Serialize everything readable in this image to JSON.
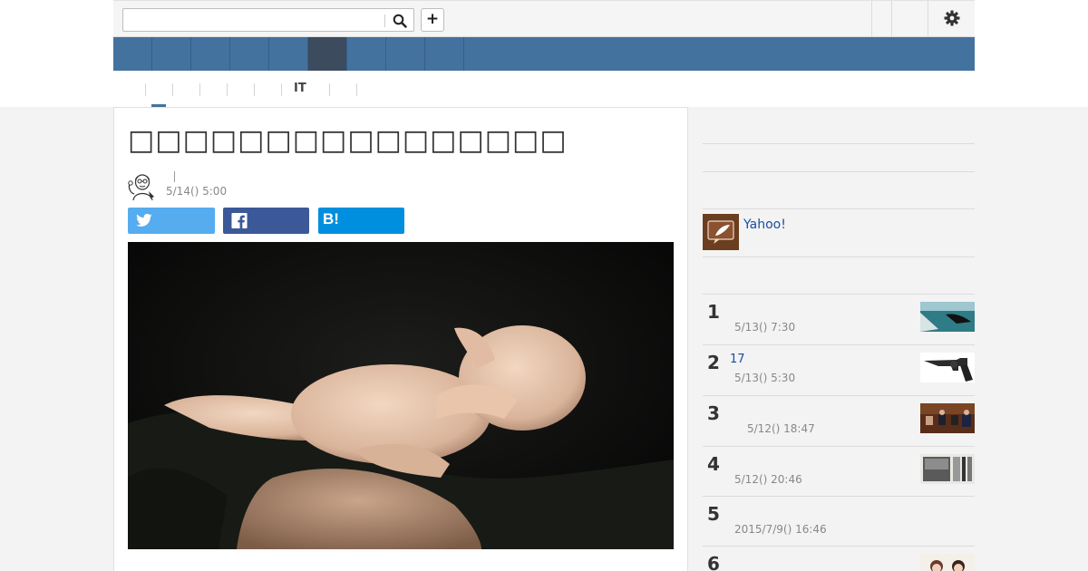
{
  "search": {
    "value": "",
    "placeholder": ""
  },
  "header": {
    "add_label": "+"
  },
  "subnav": {
    "active_label": "IT"
  },
  "article": {
    "headline": "□□□□□□□□□□□□□□□□",
    "date": "5/14() 5:00"
  },
  "share": {
    "hatena_label": "B!"
  },
  "sidebar": {
    "promo_text": "Yahoo!",
    "ranking": [
      {
        "rank": "1",
        "title": "",
        "date": "5/13() 7:30",
        "thumb": "whale-photo"
      },
      {
        "rank": "2",
        "title": "17",
        "date": "5/13() 5:30",
        "thumb": "revolver-photo"
      },
      {
        "rank": "3",
        "title": "",
        "date": "5/12() 18:47",
        "thumb": "diet-session-photo"
      },
      {
        "rank": "4",
        "title": "",
        "date": "5/12() 20:46",
        "thumb": "newspaper-photo"
      },
      {
        "rank": "5",
        "title": "",
        "date": "2015/7/9() 16:46",
        "thumb": ""
      },
      {
        "rank": "6",
        "title": "",
        "date": "",
        "thumb": "people-photo"
      }
    ]
  },
  "icons": {
    "search": "search-icon",
    "gear": "gear-icon",
    "twitter": "twitter-icon",
    "facebook": "facebook-icon",
    "promo": "quill-icon",
    "author": "author-avatar"
  },
  "colors": {
    "nav": "#43729f",
    "nav_active": "#3d4b5f",
    "twitter": "#55acee",
    "facebook": "#3b5998",
    "hatena": "#008fde",
    "link": "#1a4fa0"
  }
}
